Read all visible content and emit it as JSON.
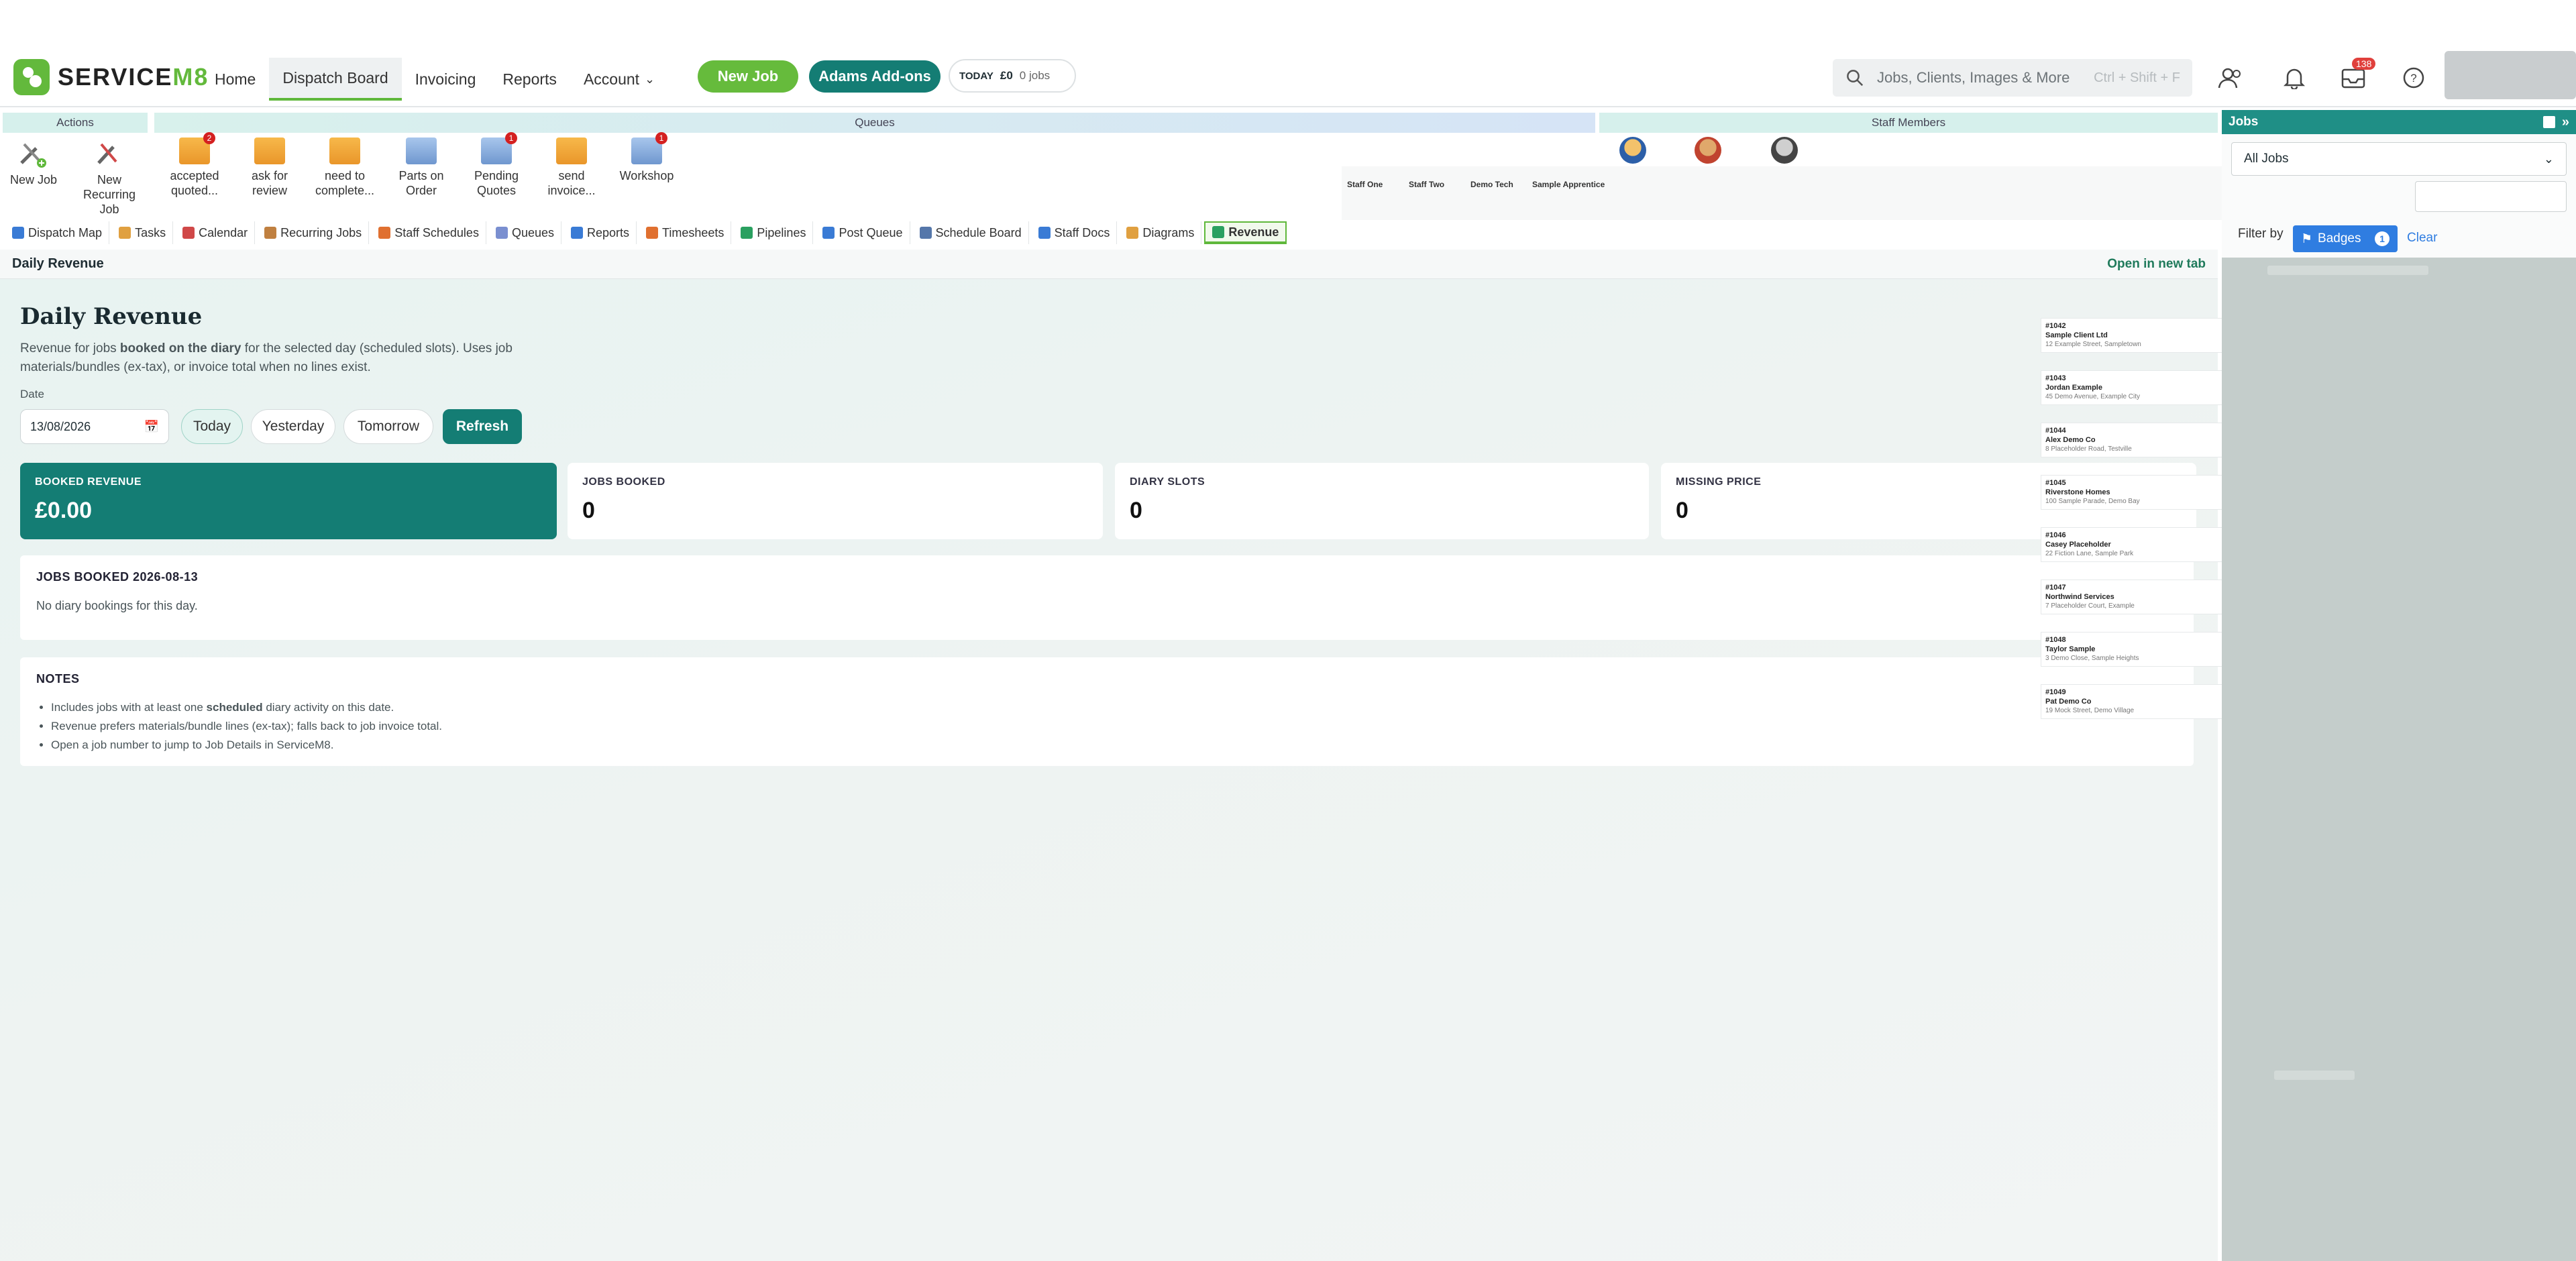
{
  "app": {
    "brand_service": "SERVICE",
    "brand_m8": "M8"
  },
  "nav": {
    "home": "Home",
    "dispatch": "Dispatch Board",
    "invoicing": "Invoicing",
    "reports": "Reports",
    "account": "Account",
    "new_job": "New Job",
    "addons": "Adams Add-ons",
    "today_label": "TODAY",
    "today_amount": "£0",
    "today_jobs": "0 jobs"
  },
  "search": {
    "placeholder": "Jobs, Clients, Images & More",
    "shortcut": "Ctrl + Shift + F"
  },
  "notifications": {
    "inbox_count": "138"
  },
  "bands": {
    "actions": "Actions",
    "queues": "Queues",
    "staff": "Staff Members"
  },
  "actions": {
    "new_job": "New Job",
    "new_recurring": "New Recurring Job"
  },
  "queues": [
    {
      "label": "accepted quoted...",
      "badge": "2",
      "color": "orange"
    },
    {
      "label": "ask for review",
      "badge": "",
      "color": "orange"
    },
    {
      "label": "need to complete...",
      "badge": "",
      "color": "orange"
    },
    {
      "label": "Parts on Order",
      "badge": "",
      "color": "blue"
    },
    {
      "label": "Pending Quotes",
      "badge": "1",
      "color": "blue"
    },
    {
      "label": "send invoice...",
      "badge": "",
      "color": "orange"
    },
    {
      "label": "Workshop",
      "badge": "1",
      "color": "blue"
    }
  ],
  "staff": [
    "Staff One",
    "Staff Two",
    "Demo Tech",
    "Sample Apprentice"
  ],
  "tabs": [
    "Dispatch Map",
    "Tasks",
    "Calendar",
    "Recurring Jobs",
    "Staff Schedules",
    "Queues",
    "Reports",
    "Timesheets",
    "Pipelines",
    "Post Queue",
    "Schedule Board",
    "Staff Docs",
    "Diagrams",
    "Revenue"
  ],
  "content": {
    "bar_title": "Daily Revenue",
    "open_new_tab": "Open in new tab",
    "title": "Daily Revenue",
    "desc_1": "Revenue for jobs ",
    "desc_bold": "booked on the diary",
    "desc_2": " for the selected day (scheduled slots). Uses job materials/bundles (ex-tax), or invoice total when no lines exist.",
    "date_label": "Date",
    "date_value": "13/08/2026",
    "btn_today": "Today",
    "btn_yesterday": "Yesterday",
    "btn_tomorrow": "Tomorrow",
    "btn_refresh": "Refresh"
  },
  "cards": [
    {
      "label": "BOOKED REVENUE",
      "value": "£0.00"
    },
    {
      "label": "JOBS BOOKED",
      "value": "0"
    },
    {
      "label": "DIARY SLOTS",
      "value": "0"
    },
    {
      "label": "MISSING PRICE",
      "value": "0"
    }
  ],
  "jobs_booked": {
    "title": "JOBS BOOKED 2026-08-13",
    "empty": "No diary bookings for this day."
  },
  "notes": {
    "title": "NOTES",
    "n1_a": "Includes jobs with at least one ",
    "n1_b": "scheduled",
    "n1_c": " diary activity on this date.",
    "n2": "Revenue prefers materials/bundle lines (ex-tax); falls back to job invoice total.",
    "n3": "Open a job number to jump to Job Details in ServiceM8."
  },
  "job_list": [
    {
      "num": "#1042",
      "client": "Sample Client Ltd",
      "addr": "12 Example Street, Sampletown"
    },
    {
      "num": "#1043",
      "client": "Jordan Example",
      "addr": "45 Demo Avenue, Example City"
    },
    {
      "num": "#1044",
      "client": "Alex Demo Co",
      "addr": "8 Placeholder Road, Testville"
    },
    {
      "num": "#1045",
      "client": "Riverstone Homes",
      "addr": "100 Sample Parade, Demo Bay"
    },
    {
      "num": "#1046",
      "client": "Casey Placeholder",
      "addr": "22 Fiction Lane, Sample Park"
    },
    {
      "num": "#1047",
      "client": "Northwind Services",
      "addr": "7 Placeholder Court, Example"
    },
    {
      "num": "#1048",
      "client": "Taylor Sample",
      "addr": "3 Demo Close, Sample Heights"
    },
    {
      "num": "#1049",
      "client": "Pat Demo Co",
      "addr": "19 Mock Street, Demo Village"
    }
  ],
  "jobs_panel": {
    "title": "Jobs",
    "filter_select": "All Jobs",
    "filter_by": "Filter by",
    "badges": "Badges",
    "badges_count": "1",
    "clear": "Clear"
  }
}
